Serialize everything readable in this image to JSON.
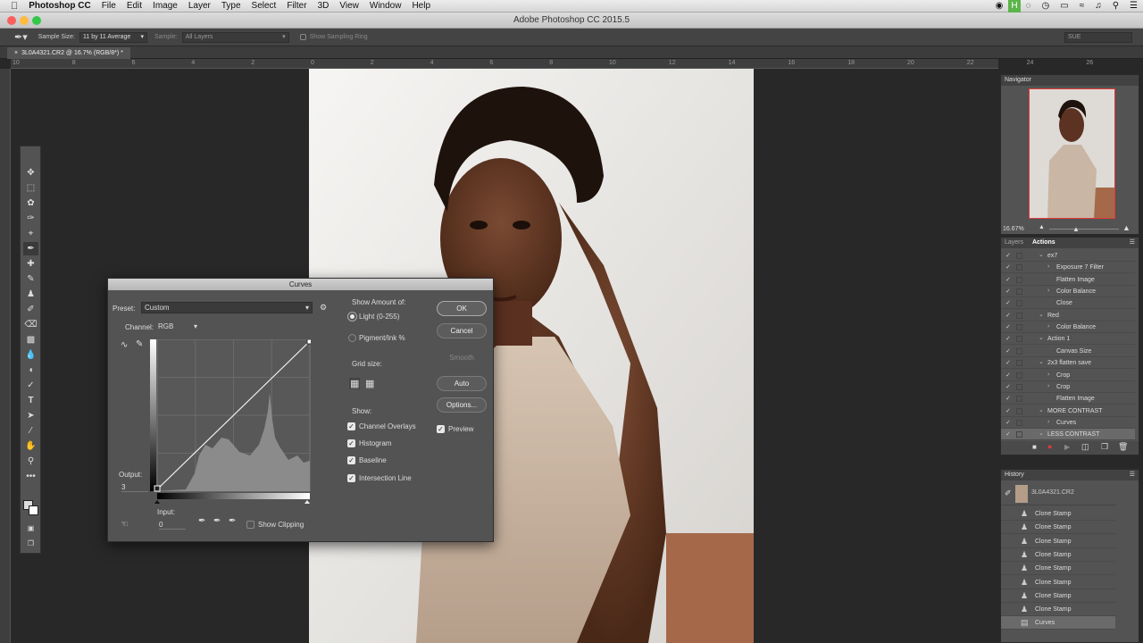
{
  "menubar": {
    "app": "Photoshop CC",
    "items": [
      "File",
      "Edit",
      "Image",
      "Layer",
      "Type",
      "Select",
      "Filter",
      "3D",
      "View",
      "Window",
      "Help"
    ]
  },
  "window": {
    "title": "Adobe Photoshop CC 2015.5"
  },
  "options": {
    "sample_size_label": "Sample Size:",
    "sample_size_value": "11 by 11 Average",
    "sample_label": "Sample:",
    "sample_value": "All Layers",
    "sampling_ring": "Show Sampling Ring",
    "workspace": "SUE"
  },
  "document": {
    "tab": "3L0A4321.CR2 @ 16.7% (RGB/8*) *"
  },
  "ruler": {
    "ticks": [
      {
        "label": "10"
      },
      {
        "label": "8"
      },
      {
        "label": "6"
      },
      {
        "label": "4"
      },
      {
        "label": "2"
      },
      {
        "label": "0"
      },
      {
        "label": "2"
      },
      {
        "label": "4"
      },
      {
        "label": "6"
      },
      {
        "label": "8"
      },
      {
        "label": "10"
      },
      {
        "label": "12"
      },
      {
        "label": "14"
      },
      {
        "label": "16"
      },
      {
        "label": "18"
      },
      {
        "label": "20"
      },
      {
        "label": "22"
      },
      {
        "label": "24"
      },
      {
        "label": "26"
      }
    ]
  },
  "curves": {
    "title": "Curves",
    "preset_label": "Preset:",
    "preset_value": "Custom",
    "channel_label": "Channel:",
    "channel_value": "RGB",
    "output_label": "Output:",
    "output_value": "3",
    "input_label": "Input:",
    "input_value": "0",
    "show_clipping": "Show Clipping",
    "show_amount_label": "Show Amount of:",
    "light": "Light  (0-255)",
    "pigment": "Pigment/Ink %",
    "grid_size_label": "Grid size:",
    "show_label": "Show:",
    "show_options": [
      "Channel Overlays",
      "Histogram",
      "Baseline",
      "Intersection Line"
    ],
    "buttons": {
      "ok": "OK",
      "cancel": "Cancel",
      "smooth": "Smooth",
      "auto": "Auto",
      "options": "Options..."
    },
    "preview": "Preview"
  },
  "navigator": {
    "title": "Navigator",
    "zoom": "16.67%"
  },
  "actions": {
    "tab_layers": "Layers",
    "tab_actions": "Actions",
    "items": [
      {
        "label": "ex7"
      },
      {
        "label": "Exposure 7 Filter"
      },
      {
        "label": "Flatten Image"
      },
      {
        "label": "Color Balance"
      },
      {
        "label": "Close"
      },
      {
        "label": "Red"
      },
      {
        "label": "Color Balance"
      },
      {
        "label": "Action 1"
      },
      {
        "label": "Canvas Size"
      },
      {
        "label": "2x3 flatten save"
      },
      {
        "label": "Crop"
      },
      {
        "label": "Crop"
      },
      {
        "label": "Flatten Image"
      },
      {
        "label": "MORE CONTRAST"
      },
      {
        "label": "Curves"
      },
      {
        "label": "LESS CONTRAST"
      }
    ]
  },
  "history": {
    "title": "History",
    "snapshot": "3L0A4321.CR2",
    "items": [
      "Clone Stamp",
      "Clone Stamp",
      "Clone Stamp",
      "Clone Stamp",
      "Clone Stamp",
      "Clone Stamp",
      "Clone Stamp",
      "Clone Stamp",
      "Curves"
    ]
  }
}
